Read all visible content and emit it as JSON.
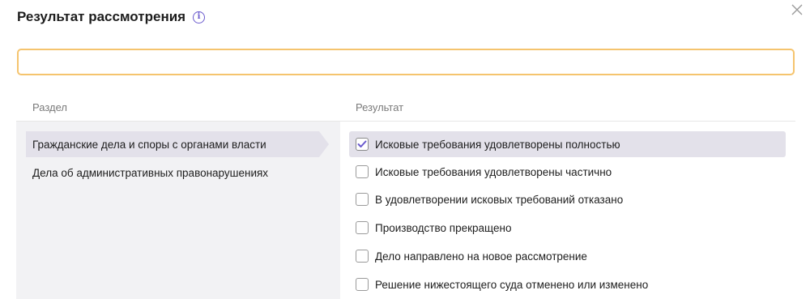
{
  "dialog": {
    "title": "Результат рассмотрения",
    "info_icon_glyph": "i"
  },
  "search": {
    "value": "",
    "placeholder": ""
  },
  "columns": {
    "section_header": "Раздел",
    "result_header": "Результат"
  },
  "sections": [
    {
      "label": "Гражданские дела и споры с органами власти",
      "active": true
    },
    {
      "label": "Дела об административных правонарушениях",
      "active": false
    }
  ],
  "results": [
    {
      "label": "Исковые требования удовлетворены полностью",
      "checked": true
    },
    {
      "label": "Исковые требования удовлетворены частично",
      "checked": false
    },
    {
      "label": "В удовлетворении исковых требований отказано",
      "checked": false
    },
    {
      "label": "Производство прекращено",
      "checked": false
    },
    {
      "label": "Дело направлено на новое рассмотрение",
      "checked": false
    },
    {
      "label": "Решение нижестоящего суда отменено или изменено",
      "checked": false
    }
  ],
  "colors": {
    "accent": "#6a5acd",
    "input_border": "#f5c46e",
    "selection": "#e3e1ea",
    "panel": "#f2f2f4"
  },
  "icons": [
    "info-icon",
    "close-icon",
    "check-icon"
  ]
}
